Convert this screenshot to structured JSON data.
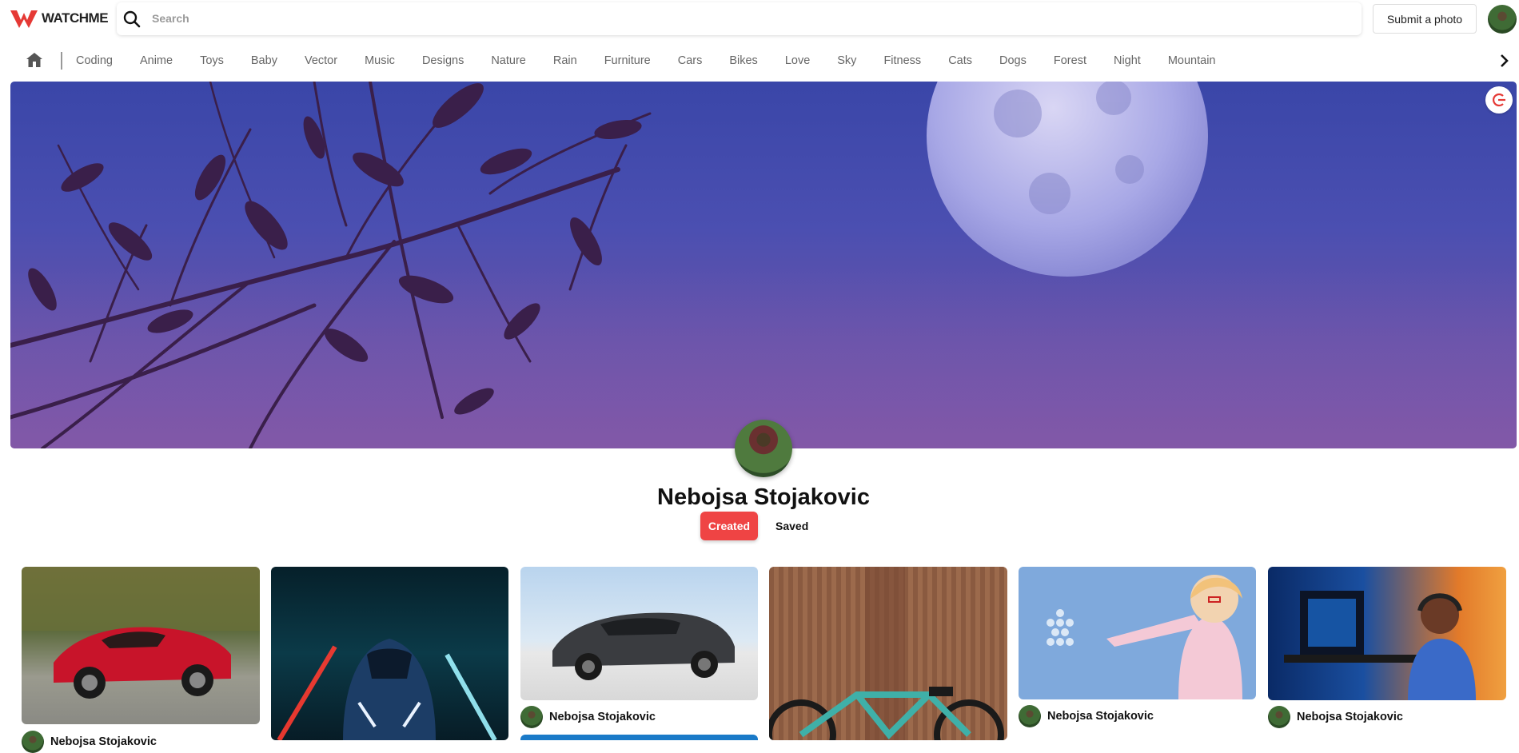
{
  "app": {
    "logo_text": "WATCHME"
  },
  "search": {
    "placeholder": "Search"
  },
  "header": {
    "submit_label": "Submit a photo"
  },
  "categories": [
    "Coding",
    "Anime",
    "Toys",
    "Baby",
    "Vector",
    "Music",
    "Designs",
    "Nature",
    "Rain",
    "Furniture",
    "Cars",
    "Bikes",
    "Love",
    "Sky",
    "Fitness",
    "Cats",
    "Dogs",
    "Forest",
    "Night",
    "Mountain"
  ],
  "profile": {
    "name": "Nebojsa Stojakovic"
  },
  "tabs": {
    "created": "Created",
    "saved": "Saved"
  },
  "pins": [
    {
      "subject": "red sports car",
      "user": "Nebojsa Stojakovic"
    },
    {
      "subject": "blue car neon tunnel",
      "user": ""
    },
    {
      "subject": "grey sedan",
      "user": "Nebojsa Stojakovic"
    },
    {
      "subject": "teal bicycle",
      "user": ""
    },
    {
      "subject": "anime girl",
      "user": "Nebojsa Stojakovic"
    },
    {
      "subject": "gamer at desk",
      "user": "Nebojsa Stojakovic"
    }
  ],
  "colors": {
    "accent": "#ef4444",
    "logo_red": "#e53935"
  }
}
